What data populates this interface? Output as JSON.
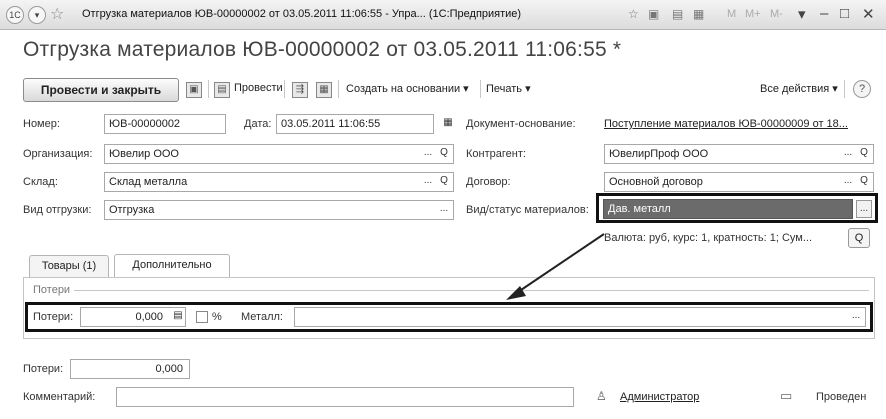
{
  "window": {
    "logo": "1С",
    "title": "Отгрузка материалов ЮВ-00000002 от 03.05.2011 11:06:55 - Упра...  (1С:Предприятие)",
    "m_buttons": [
      "M",
      "M+",
      "M-"
    ]
  },
  "document": {
    "title": "Отгрузка материалов ЮВ-00000002 от 03.05.2011 11:06:55 *"
  },
  "toolbar": {
    "post_and_close": "Провести и закрыть",
    "post": "Провести",
    "create_based_on": "Создать на основании ▾",
    "print": "Печать ▾",
    "all_actions": "Все действия ▾",
    "help": "?"
  },
  "header": {
    "number_label": "Номер:",
    "number_value": "ЮВ-00000002",
    "date_label": "Дата:",
    "date_value": "03.05.2011 11:06:55",
    "base_doc_label": "Документ-основание:",
    "base_doc_value": "Поступление материалов ЮВ-00000009 от 18...",
    "org_label": "Организация:",
    "org_value": "Ювелир ООО",
    "counterparty_label": "Контрагент:",
    "counterparty_value": "ЮвелирПроф ООО",
    "warehouse_label": "Склад:",
    "warehouse_value": "Склад металла",
    "contract_label": "Договор:",
    "contract_value": "Основной договор",
    "shipment_type_label": "Вид отгрузки:",
    "shipment_type_value": "Отгрузка",
    "material_status_label": "Вид/статус материалов:",
    "material_status_value": "Дав. металл",
    "currency_info": "Валюта: руб, курс: 1, кратность: 1; Сум..."
  },
  "tabs": [
    {
      "label": "Товары (1)",
      "active": false
    },
    {
      "label": "Дополнительно",
      "active": true
    }
  ],
  "losses_group": {
    "title": "Потери",
    "losses_label": "Потери:",
    "losses_value": "0,000",
    "percent_label": "%",
    "percent_checked": false,
    "metal_label": "Металл:",
    "metal_value": ""
  },
  "footer": {
    "losses_label": "Потери:",
    "losses_value": "0,000",
    "comment_label": "Комментарий:",
    "comment_value": "",
    "author": "Администратор",
    "status": "Проведен"
  },
  "icons": {
    "dots": "...",
    "search": "Q",
    "calendar": "▦",
    "calc": "▤"
  },
  "colors": {
    "selected_field_bg": "#6b6b6b",
    "highlight_border": "#111111",
    "arrow": "#222222"
  }
}
